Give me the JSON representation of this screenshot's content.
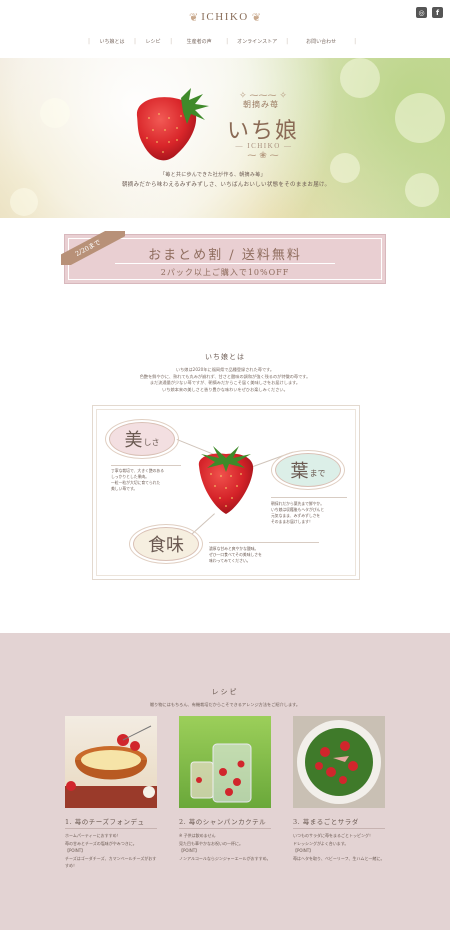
{
  "header": {
    "logo": "ICHIKO",
    "social": [
      {
        "name": "instagram-icon",
        "glyph": "◎"
      },
      {
        "name": "facebook-icon",
        "glyph": "f"
      }
    ],
    "nav": [
      "いち娘とは",
      "レシピ",
      "生産者の声",
      "オンラインストア",
      "お問い合わせ"
    ]
  },
  "hero": {
    "subtitle": "朝摘み苺",
    "title": "いち娘",
    "english": "— ICHIKO —",
    "tagline1": "「苺と共に歩んできた社が作る、朝摘み苺」",
    "tagline2": "朝摘みだから味わえるみずみずしさ、いちばんおいしい状態をそのままお届け。"
  },
  "banner": {
    "ribbon": "2/20まで",
    "title": "おまとめ割 / 送料無料",
    "subtitle": "2パック以上ご購入で10%OFF"
  },
  "about": {
    "title": "いち娘とは",
    "lines": [
      "いち娘は2020年に福岡県で品種登録された苺です。",
      "色艶を鮮やかに、熟れても丸みが崩れず、甘さと酸味の調和が強く残るのが特徴の苺です。",
      "まだ流通量が少ない苺ですが、朝摘みだからこそ届く美味しさをお届けします。",
      "いち娘本来の美しさと香り豊かな味わいをぜひお楽しみください。"
    ],
    "features": {
      "beauty": {
        "big": "美",
        "small": "しさ",
        "desc": [
          "丁寧な栽培で、大きく艶のある",
          "しっかりとした果肉。",
          "一粒一粒が大切に育てられた",
          "美しい苺です。"
        ]
      },
      "leaf": {
        "big": "葉",
        "small": "まで",
        "desc": [
          "朝採れだから葉先まで鮮やか。",
          "いち娘は収穫後もヘタがぴんと",
          "元気なまま、みずみずしさを",
          "そのままお届けします！"
        ]
      },
      "taste": {
        "big": "食味",
        "small": "",
        "desc": [
          "濃厚な甘みと爽やかな酸味。",
          "ぜひ一口食べてその美味しさを",
          "味わってみてください。"
        ]
      }
    }
  },
  "recipes": {
    "title": "レシピ",
    "lead": "贈り物にはもちろん、有機栽培だからこそできるアレンジ方法をご紹介します。",
    "cards": [
      {
        "title": "1. 苺のチーズフォンデュ",
        "body": [
          "ホームパーティーにおすすめ！",
          "苺の甘みとチーズの塩味がやみつきに。",
          "【POINT】",
          "チーズはゴーダチーズ、カマンベールチーズがおすすめ！"
        ]
      },
      {
        "title": "2. 苺のシャンパンカクテル",
        "body": [
          "※ 子供は飲めません",
          "見た目も華やかなお祝いの一杯に。",
          "【POINT】",
          "ノンアルコールならジンジャーエールがおすすめ。"
        ]
      },
      {
        "title": "3. 苺まるごとサラダ",
        "body": [
          "いつものサラダに苺をまるごとトッピング！",
          "ドレッシングがよく合います。",
          "【POINT】",
          "苺はヘタを取り、ベビーリーフ、生ハムと一緒に。"
        ]
      }
    ]
  }
}
